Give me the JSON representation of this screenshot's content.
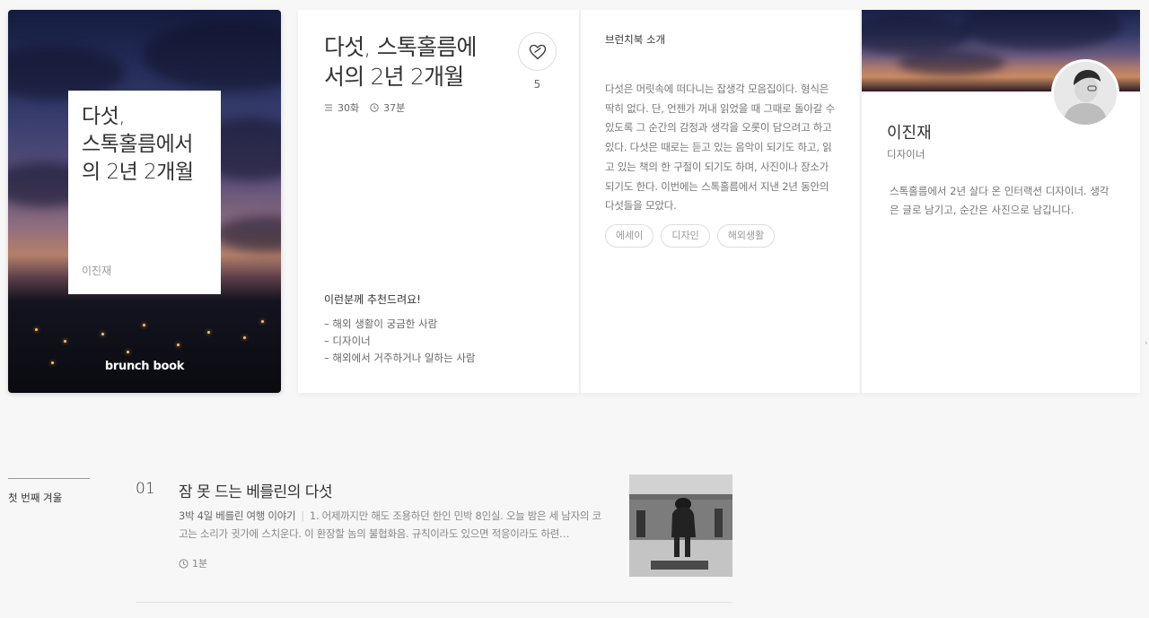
{
  "cover": {
    "title": "다섯,\n스톡홀름에서\n의 2년 2개월",
    "author": "이진재",
    "brand": "brunch book"
  },
  "book": {
    "title": "다섯, 스톡홀름에\n서의 2년 2개월",
    "episodes": "30화",
    "read_time": "37분",
    "like_count": "5",
    "recommend_title": "이런분께 추천드려요!",
    "recommend_items": [
      "해외 생활이 궁금한 사람",
      "디자이너",
      "해외에서 거주하거나 일하는 사람"
    ]
  },
  "intro": {
    "label": "브런치북 소개",
    "text": "다섯은 머릿속에 떠다니는 잡생각 모음집이다. 형식은 딱히 없다. 단, 언젠가 꺼내 읽었을 때 그때로 돌아갈 수 있도록 그 순간의 감정과 생각을 오롯이 담으려고 하고 있다. 다섯은 때로는 듣고 있는 음악이 되기도 하고, 읽고 있는 책의 한 구절이 되기도 하며, 사진이나 장소가 되기도 한다. 이번에는 스톡홀름에서 지낸 2년 동안의 다섯들을 모았다.",
    "tags": [
      "에세이",
      "디자인",
      "해외생활"
    ]
  },
  "author": {
    "name": "이진재",
    "job": "디자이너",
    "desc": "스톡홀름에서 2년 살다 온 인터랙션 디자이너. 생각은 글로 남기고, 순간은 사진으로 남깁니다."
  },
  "section": {
    "label": "첫 번째 겨울"
  },
  "article": {
    "num": "01",
    "title": "잠 못 드는 베를린의 다섯",
    "subtitle": "3박 4일 베를린 여행 이야기",
    "excerpt": "1. 어제까지만 해도 조용하던 한인 민박 8인실. 오늘 밤은 세 남자의 코 고는 소리가 귓가에 스치운다. 이 환장할 놈의 불협화음. 규칙이라도 있으면 적응이라도 하련…",
    "read_time": "1분"
  },
  "icons": {
    "episodes": "list-icon",
    "clock": "clock-icon",
    "like": "heart-icon"
  },
  "colors": {
    "background": "#f7f7f7",
    "panel": "#ffffff",
    "text": "#333333"
  }
}
